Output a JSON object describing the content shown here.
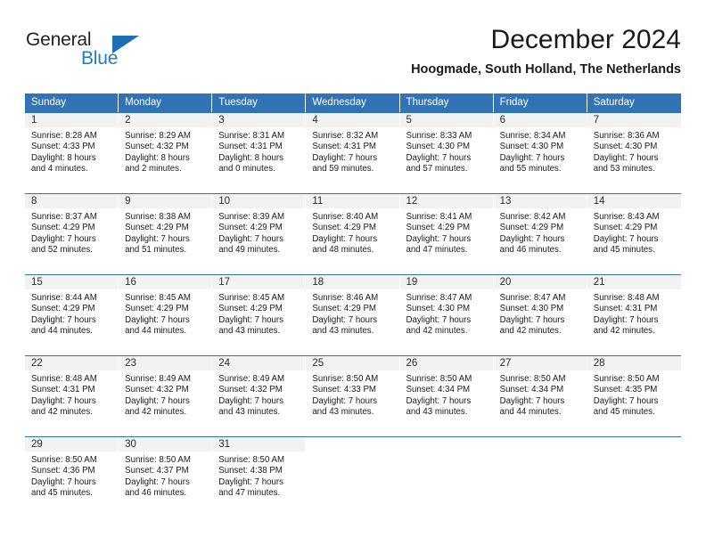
{
  "brand": {
    "name_top": "General",
    "name_bottom": "Blue",
    "triangle_icon": "blue-triangle-logo",
    "color_dark": "#231f20",
    "color_blue": "#1f7ec2"
  },
  "header": {
    "title": "December 2024",
    "subtitle": "Hoogmade, South Holland, The Netherlands"
  },
  "theme": {
    "header_bg": "#3273b5",
    "header_text": "#ffffff",
    "daynum_bg": "#f2f2f2",
    "cell_bg": "#ffffff"
  },
  "weekdays": [
    {
      "label": "Sunday"
    },
    {
      "label": "Monday"
    },
    {
      "label": "Tuesday"
    },
    {
      "label": "Wednesday"
    },
    {
      "label": "Thursday"
    },
    {
      "label": "Friday"
    },
    {
      "label": "Saturday"
    }
  ],
  "weeks": [
    [
      {
        "day": "1",
        "sunrise": "Sunrise: 8:28 AM",
        "sunset": "Sunset: 4:33 PM",
        "daylight1": "Daylight: 8 hours",
        "daylight2": "and 4 minutes."
      },
      {
        "day": "2",
        "sunrise": "Sunrise: 8:29 AM",
        "sunset": "Sunset: 4:32 PM",
        "daylight1": "Daylight: 8 hours",
        "daylight2": "and 2 minutes."
      },
      {
        "day": "3",
        "sunrise": "Sunrise: 8:31 AM",
        "sunset": "Sunset: 4:31 PM",
        "daylight1": "Daylight: 8 hours",
        "daylight2": "and 0 minutes."
      },
      {
        "day": "4",
        "sunrise": "Sunrise: 8:32 AM",
        "sunset": "Sunset: 4:31 PM",
        "daylight1": "Daylight: 7 hours",
        "daylight2": "and 59 minutes."
      },
      {
        "day": "5",
        "sunrise": "Sunrise: 8:33 AM",
        "sunset": "Sunset: 4:30 PM",
        "daylight1": "Daylight: 7 hours",
        "daylight2": "and 57 minutes."
      },
      {
        "day": "6",
        "sunrise": "Sunrise: 8:34 AM",
        "sunset": "Sunset: 4:30 PM",
        "daylight1": "Daylight: 7 hours",
        "daylight2": "and 55 minutes."
      },
      {
        "day": "7",
        "sunrise": "Sunrise: 8:36 AM",
        "sunset": "Sunset: 4:30 PM",
        "daylight1": "Daylight: 7 hours",
        "daylight2": "and 53 minutes."
      }
    ],
    [
      {
        "day": "8",
        "sunrise": "Sunrise: 8:37 AM",
        "sunset": "Sunset: 4:29 PM",
        "daylight1": "Daylight: 7 hours",
        "daylight2": "and 52 minutes."
      },
      {
        "day": "9",
        "sunrise": "Sunrise: 8:38 AM",
        "sunset": "Sunset: 4:29 PM",
        "daylight1": "Daylight: 7 hours",
        "daylight2": "and 51 minutes."
      },
      {
        "day": "10",
        "sunrise": "Sunrise: 8:39 AM",
        "sunset": "Sunset: 4:29 PM",
        "daylight1": "Daylight: 7 hours",
        "daylight2": "and 49 minutes."
      },
      {
        "day": "11",
        "sunrise": "Sunrise: 8:40 AM",
        "sunset": "Sunset: 4:29 PM",
        "daylight1": "Daylight: 7 hours",
        "daylight2": "and 48 minutes."
      },
      {
        "day": "12",
        "sunrise": "Sunrise: 8:41 AM",
        "sunset": "Sunset: 4:29 PM",
        "daylight1": "Daylight: 7 hours",
        "daylight2": "and 47 minutes."
      },
      {
        "day": "13",
        "sunrise": "Sunrise: 8:42 AM",
        "sunset": "Sunset: 4:29 PM",
        "daylight1": "Daylight: 7 hours",
        "daylight2": "and 46 minutes."
      },
      {
        "day": "14",
        "sunrise": "Sunrise: 8:43 AM",
        "sunset": "Sunset: 4:29 PM",
        "daylight1": "Daylight: 7 hours",
        "daylight2": "and 45 minutes."
      }
    ],
    [
      {
        "day": "15",
        "sunrise": "Sunrise: 8:44 AM",
        "sunset": "Sunset: 4:29 PM",
        "daylight1": "Daylight: 7 hours",
        "daylight2": "and 44 minutes."
      },
      {
        "day": "16",
        "sunrise": "Sunrise: 8:45 AM",
        "sunset": "Sunset: 4:29 PM",
        "daylight1": "Daylight: 7 hours",
        "daylight2": "and 44 minutes."
      },
      {
        "day": "17",
        "sunrise": "Sunrise: 8:45 AM",
        "sunset": "Sunset: 4:29 PM",
        "daylight1": "Daylight: 7 hours",
        "daylight2": "and 43 minutes."
      },
      {
        "day": "18",
        "sunrise": "Sunrise: 8:46 AM",
        "sunset": "Sunset: 4:29 PM",
        "daylight1": "Daylight: 7 hours",
        "daylight2": "and 43 minutes."
      },
      {
        "day": "19",
        "sunrise": "Sunrise: 8:47 AM",
        "sunset": "Sunset: 4:30 PM",
        "daylight1": "Daylight: 7 hours",
        "daylight2": "and 42 minutes."
      },
      {
        "day": "20",
        "sunrise": "Sunrise: 8:47 AM",
        "sunset": "Sunset: 4:30 PM",
        "daylight1": "Daylight: 7 hours",
        "daylight2": "and 42 minutes."
      },
      {
        "day": "21",
        "sunrise": "Sunrise: 8:48 AM",
        "sunset": "Sunset: 4:31 PM",
        "daylight1": "Daylight: 7 hours",
        "daylight2": "and 42 minutes."
      }
    ],
    [
      {
        "day": "22",
        "sunrise": "Sunrise: 8:48 AM",
        "sunset": "Sunset: 4:31 PM",
        "daylight1": "Daylight: 7 hours",
        "daylight2": "and 42 minutes."
      },
      {
        "day": "23",
        "sunrise": "Sunrise: 8:49 AM",
        "sunset": "Sunset: 4:32 PM",
        "daylight1": "Daylight: 7 hours",
        "daylight2": "and 42 minutes."
      },
      {
        "day": "24",
        "sunrise": "Sunrise: 8:49 AM",
        "sunset": "Sunset: 4:32 PM",
        "daylight1": "Daylight: 7 hours",
        "daylight2": "and 43 minutes."
      },
      {
        "day": "25",
        "sunrise": "Sunrise: 8:50 AM",
        "sunset": "Sunset: 4:33 PM",
        "daylight1": "Daylight: 7 hours",
        "daylight2": "and 43 minutes."
      },
      {
        "day": "26",
        "sunrise": "Sunrise: 8:50 AM",
        "sunset": "Sunset: 4:34 PM",
        "daylight1": "Daylight: 7 hours",
        "daylight2": "and 43 minutes."
      },
      {
        "day": "27",
        "sunrise": "Sunrise: 8:50 AM",
        "sunset": "Sunset: 4:34 PM",
        "daylight1": "Daylight: 7 hours",
        "daylight2": "and 44 minutes."
      },
      {
        "day": "28",
        "sunrise": "Sunrise: 8:50 AM",
        "sunset": "Sunset: 4:35 PM",
        "daylight1": "Daylight: 7 hours",
        "daylight2": "and 45 minutes."
      }
    ],
    [
      {
        "day": "29",
        "sunrise": "Sunrise: 8:50 AM",
        "sunset": "Sunset: 4:36 PM",
        "daylight1": "Daylight: 7 hours",
        "daylight2": "and 45 minutes."
      },
      {
        "day": "30",
        "sunrise": "Sunrise: 8:50 AM",
        "sunset": "Sunset: 4:37 PM",
        "daylight1": "Daylight: 7 hours",
        "daylight2": "and 46 minutes."
      },
      {
        "day": "31",
        "sunrise": "Sunrise: 8:50 AM",
        "sunset": "Sunset: 4:38 PM",
        "daylight1": "Daylight: 7 hours",
        "daylight2": "and 47 minutes."
      },
      {
        "day": "",
        "sunrise": "",
        "sunset": "",
        "daylight1": "",
        "daylight2": ""
      },
      {
        "day": "",
        "sunrise": "",
        "sunset": "",
        "daylight1": "",
        "daylight2": ""
      },
      {
        "day": "",
        "sunrise": "",
        "sunset": "",
        "daylight1": "",
        "daylight2": ""
      },
      {
        "day": "",
        "sunrise": "",
        "sunset": "",
        "daylight1": "",
        "daylight2": ""
      }
    ]
  ]
}
